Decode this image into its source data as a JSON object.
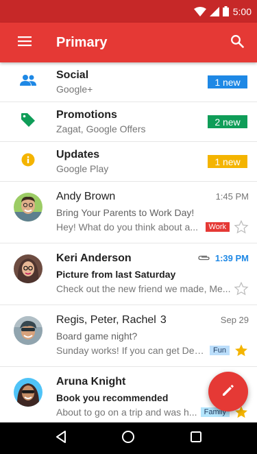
{
  "status_bar": {
    "time": "5:00"
  },
  "app_bar": {
    "title": "Primary"
  },
  "colors": {
    "app_bar": "#e53935",
    "status_bar": "#c62828",
    "social": "#1e88e5",
    "promotions": "#0f9d58",
    "updates": "#f4b400",
    "unread_time": "#1e88e5",
    "work_label": "#e53935",
    "fun_label": "#bbdefb",
    "family_label": "#b3e5fc",
    "star_on": "#f4b400"
  },
  "categories": [
    {
      "icon": "people-icon",
      "title": "Social",
      "subtitle": "Google+",
      "badge": "1 new",
      "color": "#1e88e5"
    },
    {
      "icon": "tag-icon",
      "title": "Promotions",
      "subtitle": "Zagat, Google Offers",
      "badge": "2 new",
      "color": "#0f9d58"
    },
    {
      "icon": "info-icon",
      "title": "Updates",
      "subtitle": "Google Play",
      "badge": "1 new",
      "color": "#f4b400"
    }
  ],
  "emails": [
    {
      "sender": "Andy Brown",
      "count": "",
      "time": "1:45 PM",
      "subject": "Bring Your Parents to Work Day!",
      "snippet": "Hey! What do you think about a...",
      "label": "Work",
      "starred": false,
      "unread": false
    },
    {
      "sender": "Keri Anderson",
      "count": "",
      "time": "1:39 PM",
      "subject": "Picture from last Saturday",
      "snippet": "Check out the new friend we made, Me...",
      "label": "",
      "starred": false,
      "unread": true,
      "attachment": true
    },
    {
      "sender": "Regis, Peter, Rachel",
      "count": "3",
      "time": "Sep 29",
      "subject": "Board game night?",
      "snippet": "Sunday works! If you can get Dex...",
      "label": "Fun",
      "starred": true,
      "unread": false
    },
    {
      "sender": "Aruna Knight",
      "count": "",
      "time": "",
      "subject": "Book you recommended",
      "snippet": "About to go on a trip and was h...",
      "label": "Family",
      "starred": true,
      "unread": true
    }
  ]
}
